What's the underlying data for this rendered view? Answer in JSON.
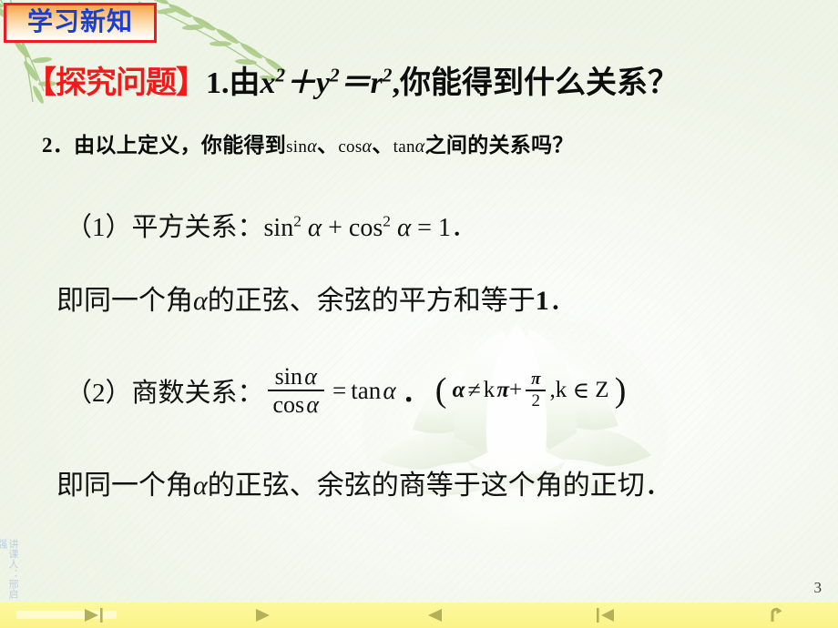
{
  "slide": {
    "badge_label": "学习新知",
    "page_number": "3",
    "watermark": "讲课人：邢启强"
  },
  "questions": {
    "bracket_open": "【",
    "bracket_label": "探究问题",
    "bracket_close": "】",
    "q1_number": "1.",
    "q1_text_before": "由",
    "q1_expr": "x²＋y²＝r²",
    "q1_text_after": ",你能得到什么关系？",
    "q2_number": "2．",
    "q2_text_before": "由以上定义，你能得到",
    "q2_fn1": "sin",
    "q2_fn2": "cos",
    "q2_fn3": "tan",
    "q2_alpha": "α",
    "q2_sep": "、",
    "q2_text_after": "之间的关系吗？"
  },
  "relations": [
    {
      "label": "（1）平方关系：",
      "formula": "sin²α＋cos²α＝1．",
      "note": "即同一个角α的正弦、余弦的平方和等于1．"
    },
    {
      "label": "（2）商数关系：",
      "numerator": "sin α",
      "denominator": "cos α",
      "equals": "=",
      "rhs": "tan α",
      "dot": "．",
      "cond_open": "(",
      "cond_alpha": "α",
      "cond_neq": "≠",
      "cond_k1": "k",
      "cond_pi": "π",
      "cond_plus": "+",
      "cond_frac_top": "π",
      "cond_frac_bot": "2",
      "cond_comma": ",",
      "cond_k2": "k",
      "cond_in": "∈",
      "cond_set": "Z",
      "cond_close": ")",
      "note": "即同一个角α的正弦、余弦的商等于这个角的正切．"
    }
  ],
  "navbar": {
    "buttons": [
      {
        "name": "play-to-end-button",
        "icon": "play-end-icon",
        "label": "▶|"
      },
      {
        "name": "play-button",
        "icon": "play-icon",
        "label": "▶"
      },
      {
        "name": "previous-button",
        "icon": "play-back-icon",
        "label": "◀"
      },
      {
        "name": "first-slide-button",
        "icon": "skip-back-icon",
        "label": "|◀"
      },
      {
        "name": "return-button",
        "icon": "return-arrow-icon",
        "label": "↵"
      }
    ]
  },
  "colors": {
    "badge_border": "#ec1c24",
    "badge_text": "#1a3fd0",
    "bracket_red": "#ee1b1b",
    "navbar_bg": "#fdf79a",
    "nav_icon": "#b3b05a",
    "watermark": "#b7c9dd",
    "leaf_green": "#9cc47a"
  }
}
